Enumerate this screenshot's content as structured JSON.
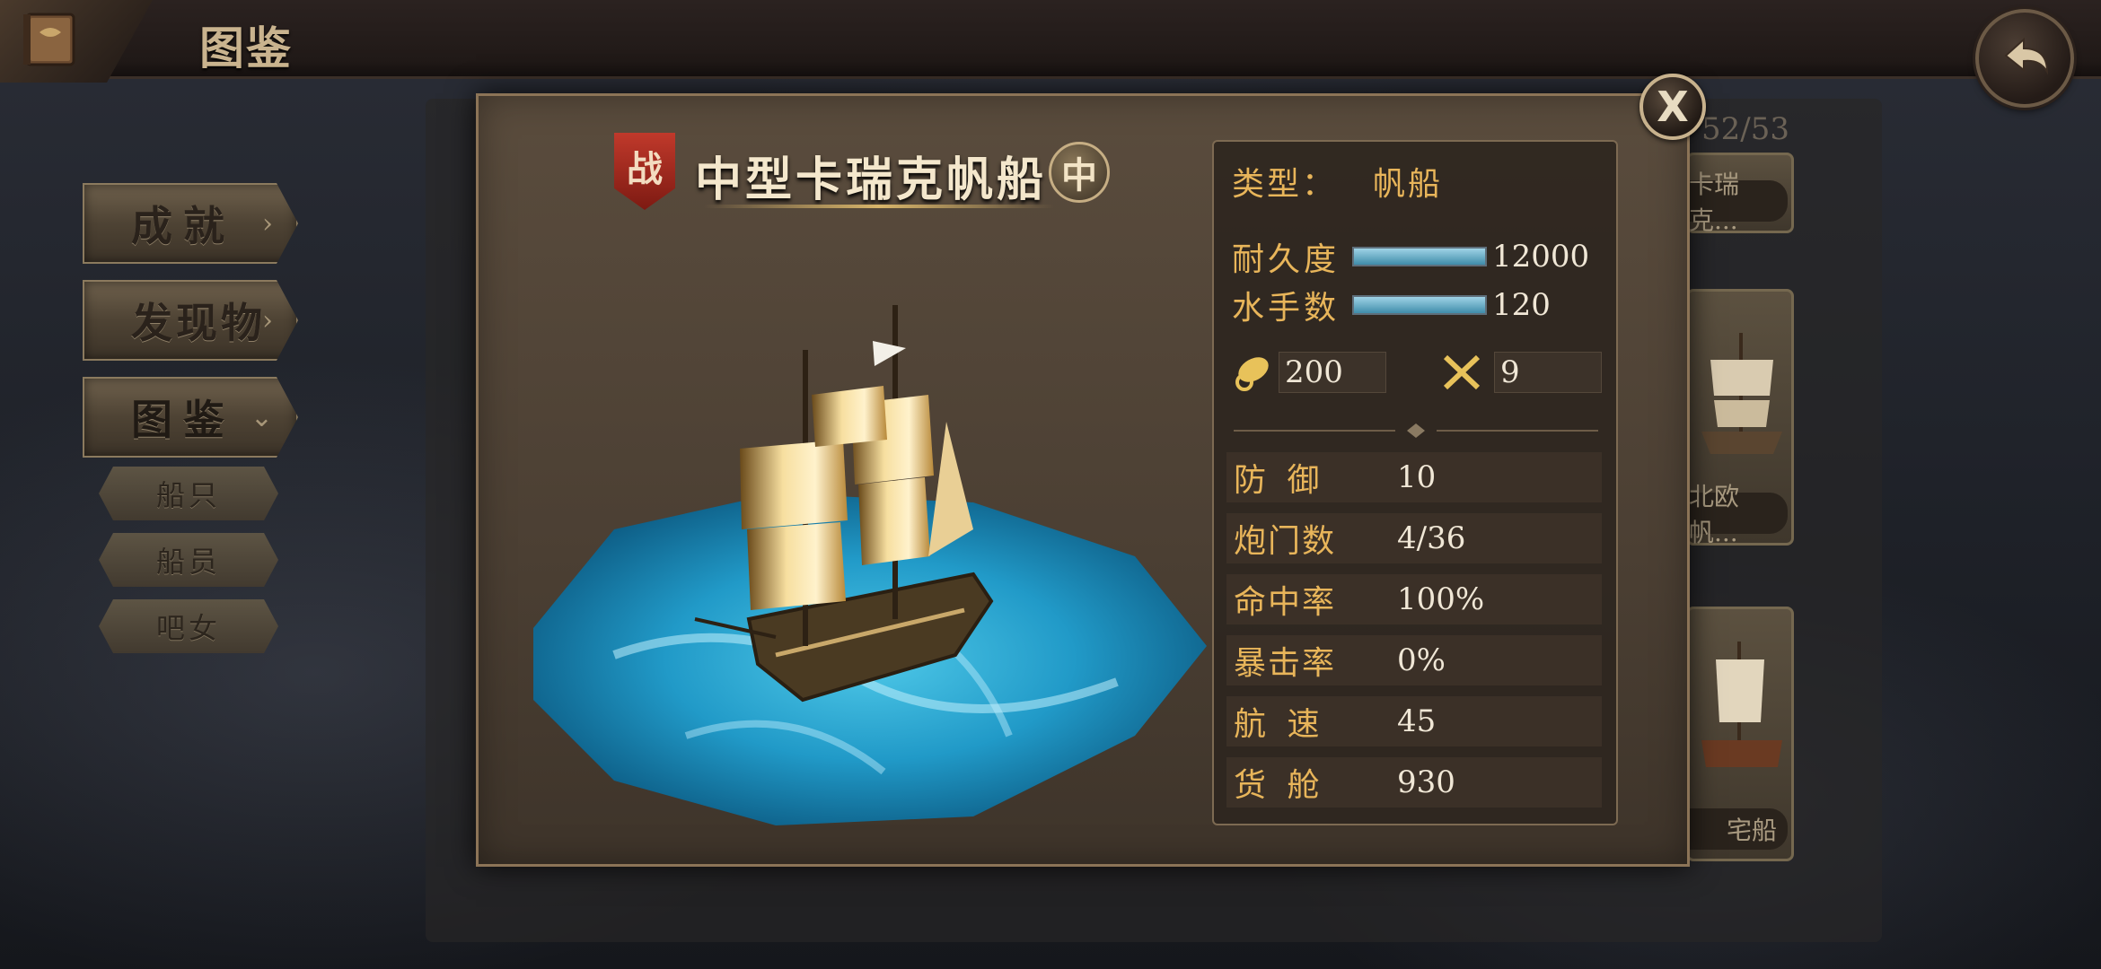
{
  "header": {
    "title": "图鉴"
  },
  "menu": {
    "items": [
      {
        "label": "成就"
      },
      {
        "label": "发现物"
      },
      {
        "label": "图鉴"
      }
    ],
    "sub_items": [
      {
        "label": "船只"
      },
      {
        "label": "船员"
      },
      {
        "label": "吧女"
      }
    ]
  },
  "collection": {
    "counter": "52/53",
    "right_cards": [
      {
        "label": "卡瑞克..."
      },
      {
        "label": "北欧帆..."
      },
      {
        "label": "宅船"
      }
    ]
  },
  "dialog": {
    "war_badge": "战",
    "ship_name": "中型卡瑞克帆船",
    "size_badge": "中",
    "close_label": "X",
    "type_label": "类型：",
    "type_value": "帆船",
    "durability_label": "耐久度",
    "durability_value": "12000",
    "durability_fill": 1.0,
    "sailors_label": "水手数",
    "sailors_value": "120",
    "sailors_fill": 1.0,
    "cannon_value": "200",
    "melee_value": "9",
    "stats": [
      {
        "key": "防 御",
        "value": "10"
      },
      {
        "key": "炮门数",
        "value": "4/36"
      },
      {
        "key": "命中率",
        "value": "100%"
      },
      {
        "key": "暴击率",
        "value": "0%"
      },
      {
        "key": "航 速",
        "value": "45"
      },
      {
        "key": "货 舱",
        "value": "930"
      }
    ]
  },
  "colors": {
    "accent_gold": "#e8b55a",
    "water": "#29a9d6",
    "panel": "#4b3f33"
  }
}
